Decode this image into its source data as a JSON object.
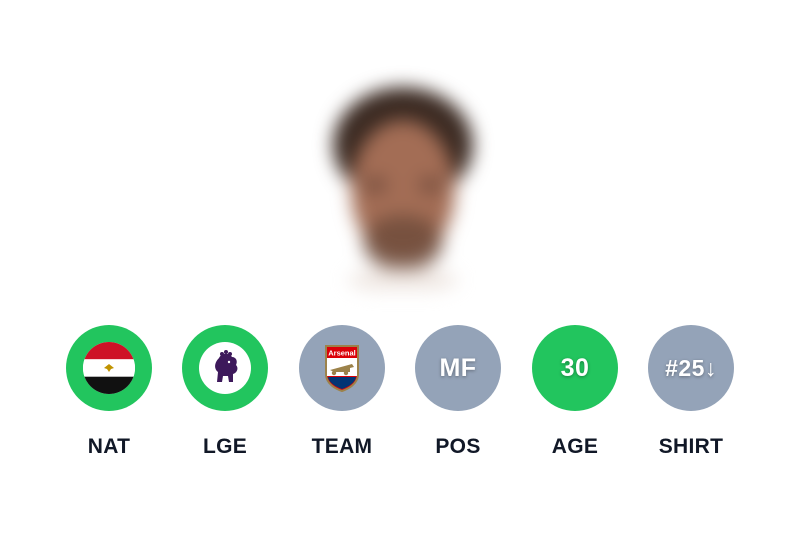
{
  "hints": [
    {
      "label": "NAT",
      "icon": "egypt-flag-icon",
      "status": "correct",
      "color": "#22c55e"
    },
    {
      "label": "LGE",
      "icon": "premier-league-lion-icon",
      "status": "correct",
      "color": "#22c55e"
    },
    {
      "label": "TEAM",
      "icon": "arsenal-crest-icon",
      "crest_text": "Arsenal",
      "status": "wrong",
      "color": "#94a3b8"
    },
    {
      "label": "POS",
      "value": "MF",
      "status": "wrong",
      "color": "#94a3b8"
    },
    {
      "label": "AGE",
      "value": "30",
      "status": "correct",
      "color": "#22c55e"
    },
    {
      "label": "SHIRT",
      "value": "#25↓",
      "status": "wrong",
      "color": "#94a3b8"
    }
  ]
}
